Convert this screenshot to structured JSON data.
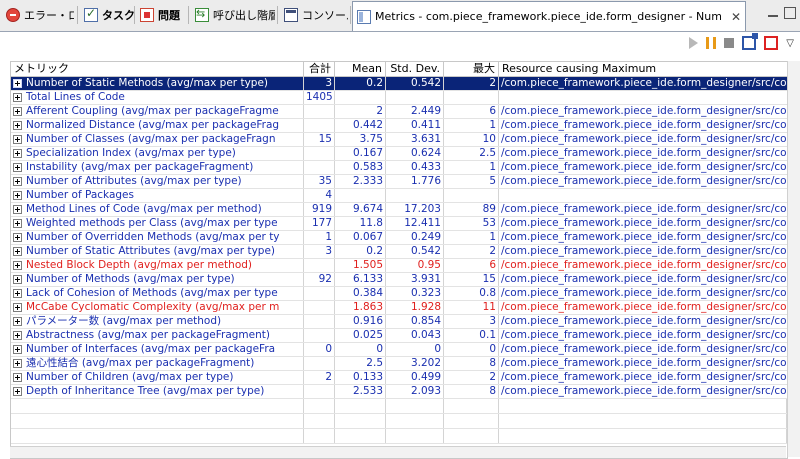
{
  "tabs": [
    {
      "label": "エラー・ログ",
      "icon": "error-log-icon",
      "bold": false,
      "active": false
    },
    {
      "label": "タスク",
      "icon": "task-icon",
      "bold": true,
      "active": false
    },
    {
      "label": "問題",
      "icon": "problem-icon",
      "bold": true,
      "active": false
    },
    {
      "label": "呼び出し階層",
      "icon": "call-hierarchy-icon",
      "bold": false,
      "active": false
    },
    {
      "label": "コンソール",
      "icon": "console-icon",
      "bold": false,
      "active": false
    },
    {
      "label": "Metrics - com.piece_framework.piece_ide.form_designer - Number of S",
      "icon": "metrics-icon",
      "bold": false,
      "active": true
    }
  ],
  "close_glyph": "✕",
  "menu_glyph": "▽",
  "headers": {
    "name": "メトリック",
    "sum": "合計",
    "mean": "Mean",
    "std": "Std. Dev.",
    "max": "最大",
    "resource": "Resource causing Maximum"
  },
  "rows": [
    {
      "name": "Number of Static Methods (avg/max per type)",
      "sum": "3",
      "mean": "0.2",
      "std": "0.542",
      "max": "2",
      "resource": "/com.piece_framework.piece_ide.form_designer/src/com...",
      "selected": true,
      "red": false
    },
    {
      "name": "Total Lines of Code",
      "sum": "1405",
      "mean": "",
      "std": "",
      "max": "",
      "resource": "",
      "selected": false,
      "red": false
    },
    {
      "name": "Afferent Coupling (avg/max per packageFragme",
      "sum": "",
      "mean": "2",
      "std": "2.449",
      "max": "6",
      "resource": "/com.piece_framework.piece_ide.form_designer/src/com...",
      "selected": false,
      "red": false
    },
    {
      "name": "Normalized Distance (avg/max per packageFrag",
      "sum": "",
      "mean": "0.442",
      "std": "0.411",
      "max": "1",
      "resource": "/com.piece_framework.piece_ide.form_designer/src/com...",
      "selected": false,
      "red": false
    },
    {
      "name": "Number of Classes (avg/max per packageFragn",
      "sum": "15",
      "mean": "3.75",
      "std": "3.631",
      "max": "10",
      "resource": "/com.piece_framework.piece_ide.form_designer/src/com...",
      "selected": false,
      "red": false
    },
    {
      "name": "Specialization Index (avg/max per type)",
      "sum": "",
      "mean": "0.167",
      "std": "0.624",
      "max": "2.5",
      "resource": "/com.piece_framework.piece_ide.form_designer/src/com...",
      "selected": false,
      "red": false
    },
    {
      "name": "Instability (avg/max per packageFragment)",
      "sum": "",
      "mean": "0.583",
      "std": "0.433",
      "max": "1",
      "resource": "/com.piece_framework.piece_ide.form_designer/src/com...",
      "selected": false,
      "red": false
    },
    {
      "name": "Number of Attributes (avg/max per type)",
      "sum": "35",
      "mean": "2.333",
      "std": "1.776",
      "max": "5",
      "resource": "/com.piece_framework.piece_ide.form_designer/src/com...",
      "selected": false,
      "red": false
    },
    {
      "name": "Number of Packages",
      "sum": "4",
      "mean": "",
      "std": "",
      "max": "",
      "resource": "",
      "selected": false,
      "red": false
    },
    {
      "name": "Method Lines of Code (avg/max per method)",
      "sum": "919",
      "mean": "9.674",
      "std": "17.203",
      "max": "89",
      "resource": "/com.piece_framework.piece_ide.form_designer/src/com...",
      "selected": false,
      "red": false
    },
    {
      "name": "Weighted methods per Class (avg/max per type",
      "sum": "177",
      "mean": "11.8",
      "std": "12.411",
      "max": "53",
      "resource": "/com.piece_framework.piece_ide.form_designer/src/com...",
      "selected": false,
      "red": false
    },
    {
      "name": "Number of Overridden Methods (avg/max per ty",
      "sum": "1",
      "mean": "0.067",
      "std": "0.249",
      "max": "1",
      "resource": "/com.piece_framework.piece_ide.form_designer/src/com...",
      "selected": false,
      "red": false
    },
    {
      "name": "Number of Static Attributes (avg/max per type)",
      "sum": "3",
      "mean": "0.2",
      "std": "0.542",
      "max": "2",
      "resource": "/com.piece_framework.piece_ide.form_designer/src/com...",
      "selected": false,
      "red": false
    },
    {
      "name": "Nested Block Depth (avg/max per method)",
      "sum": "",
      "mean": "1.505",
      "std": "0.95",
      "max": "6",
      "resource": "/com.piece_framework.piece_ide.form_designer/src/com...",
      "selected": false,
      "red": true
    },
    {
      "name": "Number of Methods (avg/max per type)",
      "sum": "92",
      "mean": "6.133",
      "std": "3.931",
      "max": "15",
      "resource": "/com.piece_framework.piece_ide.form_designer/src/com...",
      "selected": false,
      "red": false
    },
    {
      "name": "Lack of Cohesion of Methods (avg/max per type",
      "sum": "",
      "mean": "0.384",
      "std": "0.323",
      "max": "0.8",
      "resource": "/com.piece_framework.piece_ide.form_designer/src/com...",
      "selected": false,
      "red": false
    },
    {
      "name": "McCabe Cyclomatic Complexity (avg/max per m",
      "sum": "",
      "mean": "1.863",
      "std": "1.928",
      "max": "11",
      "resource": "/com.piece_framework.piece_ide.form_designer/src/com...",
      "selected": false,
      "red": true
    },
    {
      "name": "パラメーター数 (avg/max per method)",
      "sum": "",
      "mean": "0.916",
      "std": "0.854",
      "max": "3",
      "resource": "/com.piece_framework.piece_ide.form_designer/src/com...",
      "selected": false,
      "red": false
    },
    {
      "name": "Abstractness (avg/max per packageFragment)",
      "sum": "",
      "mean": "0.025",
      "std": "0.043",
      "max": "0.1",
      "resource": "/com.piece_framework.piece_ide.form_designer/src/com...",
      "selected": false,
      "red": false
    },
    {
      "name": "Number of Interfaces (avg/max per packageFra",
      "sum": "0",
      "mean": "0",
      "std": "0",
      "max": "0",
      "resource": "/com.piece_framework.piece_ide.form_designer/src/com...",
      "selected": false,
      "red": false
    },
    {
      "name": "遠心性結合 (avg/max per packageFragment)",
      "sum": "",
      "mean": "2.5",
      "std": "3.202",
      "max": "8",
      "resource": "/com.piece_framework.piece_ide.form_designer/src/com...",
      "selected": false,
      "red": false
    },
    {
      "name": "Number of Children (avg/max per type)",
      "sum": "2",
      "mean": "0.133",
      "std": "0.499",
      "max": "2",
      "resource": "/com.piece_framework.piece_ide.form_designer/src/com...",
      "selected": false,
      "red": false
    },
    {
      "name": "Depth of Inheritance Tree (avg/max per type)",
      "sum": "",
      "mean": "2.533",
      "std": "2.093",
      "max": "8",
      "resource": "/com.piece_framework.piece_ide.form_designer/src/com...",
      "selected": false,
      "red": false
    }
  ],
  "colors": {
    "link_text": "#1a2fb0",
    "warning_text": "#e0201e",
    "selection": "#0a2478"
  }
}
